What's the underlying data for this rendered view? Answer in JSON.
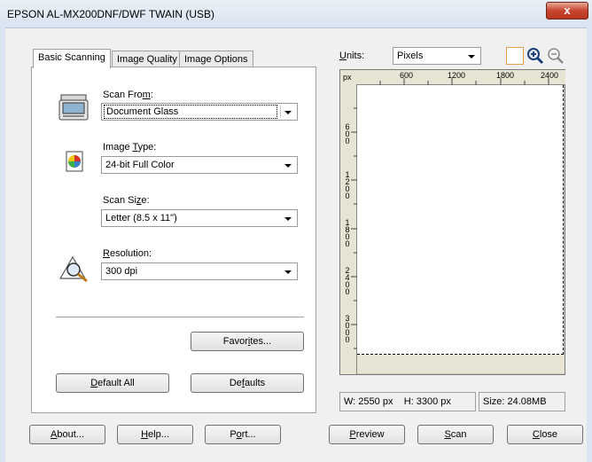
{
  "window": {
    "title": "EPSON AL-MX200DNF/DWF TWAIN (USB)",
    "close_glyph": "x"
  },
  "tabs": [
    {
      "label": "Basic Scanning",
      "active": true
    },
    {
      "label": "Image Quality",
      "active": false
    },
    {
      "label": "Image Options",
      "active": false
    }
  ],
  "basic": {
    "scan_from": {
      "label_pre": "Scan Fro",
      "label_accel": "m",
      "label_post": ":",
      "value": "Document Glass",
      "icon": "scanner-icon"
    },
    "image_type": {
      "label_pre": "Image ",
      "label_accel": "T",
      "label_post": "ype:",
      "value": "24-bit Full Color",
      "icon": "color-palette-icon"
    },
    "scan_size": {
      "label_pre": "Scan Si",
      "label_accel": "z",
      "label_post": "e:",
      "value": "Letter (8.5 x 11\")"
    },
    "resolution": {
      "label_pre": "",
      "label_accel": "R",
      "label_post": "esolution:",
      "value": "300 dpi",
      "icon": "magnifier-resolution-icon"
    }
  },
  "buttons": {
    "favorites": {
      "pre": "Favor",
      "accel": "i",
      "post": "tes..."
    },
    "default_all": {
      "pre": "",
      "accel": "D",
      "post": "efault All"
    },
    "defaults": {
      "pre": "De",
      "accel": "f",
      "post": "aults"
    },
    "about": {
      "pre": "",
      "accel": "A",
      "post": "bout..."
    },
    "help": {
      "pre": "",
      "accel": "H",
      "post": "elp..."
    },
    "port": {
      "pre": "P",
      "accel": "o",
      "post": "rt..."
    },
    "preview": {
      "pre": "",
      "accel": "P",
      "post": "review"
    },
    "scan": {
      "pre": "",
      "accel": "S",
      "post": "can"
    },
    "close": {
      "pre": "",
      "accel": "C",
      "post": "lose"
    }
  },
  "preview": {
    "units_label_accel": "U",
    "units_label_post": "nits:",
    "units_value": "Pixels",
    "ruler_unit": "px",
    "ruler_h_ticks": [
      "600",
      "1200",
      "1800",
      "2400"
    ],
    "ruler_v_ticks": [
      "600",
      "1200",
      "1800",
      "2400",
      "3000"
    ],
    "status_w": "W:  2550 px",
    "status_h": "H:  3300 px",
    "status_size": "Size: 24.08MB",
    "tools": [
      "selection-marquee-icon",
      "zoom-in-icon",
      "zoom-out-icon"
    ]
  }
}
